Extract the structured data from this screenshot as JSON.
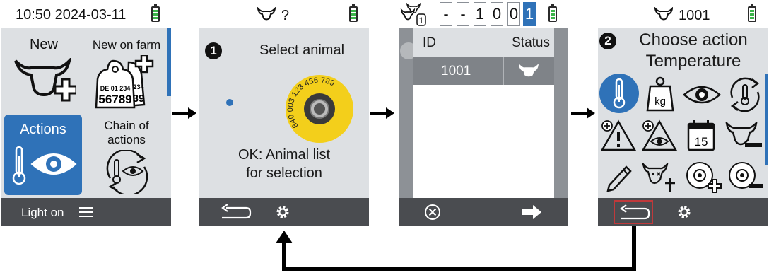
{
  "screen1": {
    "status_time": "10:50 2024-03-11",
    "tile_new": "New",
    "tile_new_on_farm": "New on farm",
    "ear_tag_number_top": "DE 01 234",
    "ear_tag_number_main": "56789",
    "ear_tag_back_top": "234",
    "ear_tag_back_main": "39",
    "tile_actions": "Actions",
    "tile_chain_line1": "Chain of",
    "tile_chain_line2": "actions",
    "footer_light": "Light on",
    "icons": [
      "cow-plus-icon",
      "ear-tag-plus-icon",
      "thermometer-icon",
      "eye-icon",
      "chain-cycle-icon",
      "menu-icon"
    ]
  },
  "screen2": {
    "status_animal": "?",
    "step_number": "1",
    "title": "Select animal",
    "tag_text": "840 003 123 456 789",
    "hint_line1": "OK: Animal list",
    "hint_line2": "for selection",
    "icons": [
      "cow-head-icon",
      "back-arrow-icon",
      "gear-icon",
      "bolus-tag-icon"
    ]
  },
  "screen3": {
    "digits": [
      "-",
      "-",
      "1",
      "0",
      "0",
      "1"
    ],
    "selected_digit_index": 5,
    "col_id": "ID",
    "col_status": "Status",
    "row_id": "1001",
    "step_hint": "1",
    "icons": [
      "herd-count-icon",
      "cow-head-icon",
      "cancel-icon",
      "forward-arrow-icon"
    ]
  },
  "screen4": {
    "status_animal": "1001",
    "step_number": "2",
    "title_line1": "Choose action",
    "title_line2": "Temperature",
    "weight_label": "kg",
    "calendar_day": "15",
    "icons": [
      "thermometer-icon",
      "weight-icon",
      "eye-icon",
      "temperature-cycle-icon",
      "warning-add-icon",
      "observation-add-icon",
      "calendar-icon",
      "cow-remove-icon",
      "edit-pencil-icon",
      "dead-animal-icon",
      "tag-add-icon",
      "tag-remove-icon",
      "back-arrow-icon",
      "gear-icon"
    ]
  },
  "colors": {
    "accent": "#2f72b8",
    "panel": "#dde0e3",
    "footer": "#4a4c50",
    "battery": "#3bb54a",
    "tag_yellow": "#f3cf1b",
    "highlight_border": "#c0393b"
  }
}
